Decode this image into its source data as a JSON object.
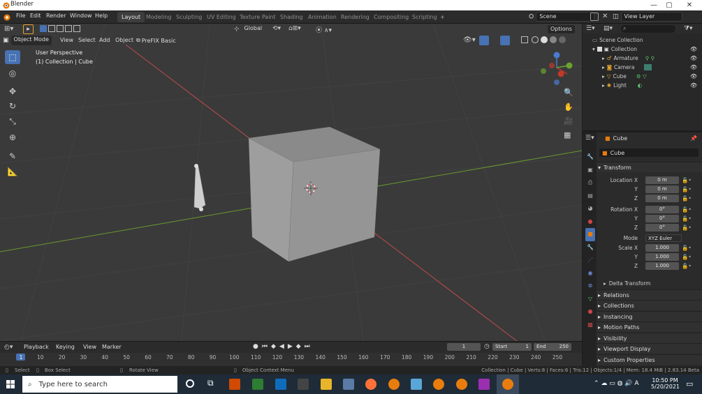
{
  "window": {
    "title": "Blender",
    "min": "—",
    "max": "▢",
    "close": "✕"
  },
  "menus": [
    "File",
    "Edit",
    "Render",
    "Window",
    "Help"
  ],
  "workspaces": [
    "Layout",
    "Modeling",
    "Sculpting",
    "UV Editing",
    "Texture Paint",
    "Shading",
    "Animation",
    "Rendering",
    "Compositing",
    "Scripting",
    "+"
  ],
  "scene": {
    "scene_label": "Scene",
    "view_layer": "View Layer"
  },
  "viewport": {
    "mode": "Object Mode",
    "view": "View",
    "select": "Select",
    "add": "Add",
    "object": "Object",
    "prefix": "PreFIX Basic",
    "orientation": "Global",
    "options": "Options",
    "info_line1": "User Perspective",
    "info_line2": "(1) Collection | Cube"
  },
  "outliner": {
    "root": "Scene Collection",
    "collection": "Collection",
    "items": [
      "Armature",
      "Camera",
      "Cube",
      "Light"
    ]
  },
  "properties": {
    "object_name": "Cube",
    "data_name": "Cube",
    "transform": "Transform",
    "location_x": "Location X",
    "rotation_x": "Rotation X",
    "scale_x": "Scale X",
    "y": "Y",
    "z": "Z",
    "loc": [
      "0 m",
      "0 m",
      "0 m"
    ],
    "rot": [
      "0°",
      "0°",
      "0°"
    ],
    "scale": [
      "1.000",
      "1.000",
      "1.000"
    ],
    "mode_label": "Mode",
    "mode_value": "XYZ Euler",
    "delta": "Delta Transform",
    "panels": [
      "Relations",
      "Collections",
      "Instancing",
      "Motion Paths",
      "Visibility",
      "Viewport Display",
      "Custom Properties"
    ]
  },
  "timeline": {
    "playback": "Playback",
    "keying": "Keying",
    "view": "View",
    "marker": "Marker",
    "current": "1",
    "start_label": "Start",
    "start": "1",
    "end_label": "End",
    "end": "250",
    "ticks": [
      "1",
      "10",
      "20",
      "30",
      "40",
      "50",
      "60",
      "70",
      "80",
      "90",
      "100",
      "110",
      "120",
      "130",
      "140",
      "150",
      "160",
      "170",
      "180",
      "190",
      "200",
      "210",
      "220",
      "230",
      "240",
      "250"
    ]
  },
  "status": {
    "select": "Select",
    "box": "Box Select",
    "rotate": "Rotate View",
    "context": "Object Context Menu",
    "info": "Collection | Cube | Verts:8 | Faces:6 | Tris:12 | Objects:1/4 | Mem: 18.4 MiB | 2.83.14 Beta"
  },
  "taskbar": {
    "search": "Type here to search",
    "time": "10:50 PM",
    "date": "5/20/2021"
  },
  "colors": {
    "accent": "#4772b3",
    "orange": "#e87d0d",
    "grid_red": "#c04b4b",
    "grid_green": "#6b9a2e"
  }
}
